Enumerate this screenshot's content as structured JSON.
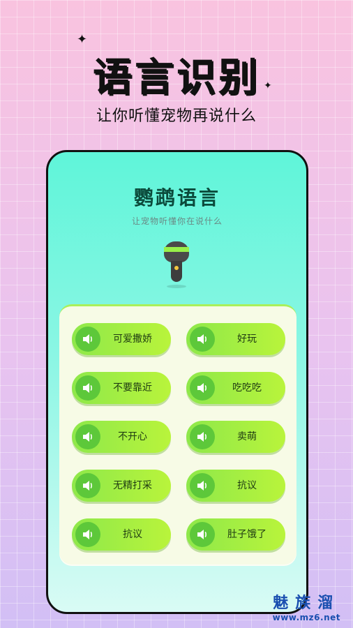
{
  "hero": {
    "title": "语言识别",
    "subtitle": "让你听懂宠物再说什么"
  },
  "app": {
    "title": "鹦鹉语言",
    "subtitle": "让宠物听懂你在说什么",
    "mic_icon": "microphone-icon"
  },
  "phrases": [
    {
      "label": "可爱撒娇"
    },
    {
      "label": "好玩"
    },
    {
      "label": "不要靠近"
    },
    {
      "label": "吃吃吃"
    },
    {
      "label": "不开心"
    },
    {
      "label": "卖萌"
    },
    {
      "label": "无精打采"
    },
    {
      "label": "抗议"
    },
    {
      "label": "抗议"
    },
    {
      "label": "肚子饿了"
    }
  ],
  "phrase_icon": "speaker-icon",
  "watermark": {
    "main": "魅族溜",
    "url": "www.mz6.net"
  },
  "colors": {
    "accent": "#98f04a",
    "phone_top": "#5ff5d9",
    "watermark": "#1a4fb0"
  }
}
